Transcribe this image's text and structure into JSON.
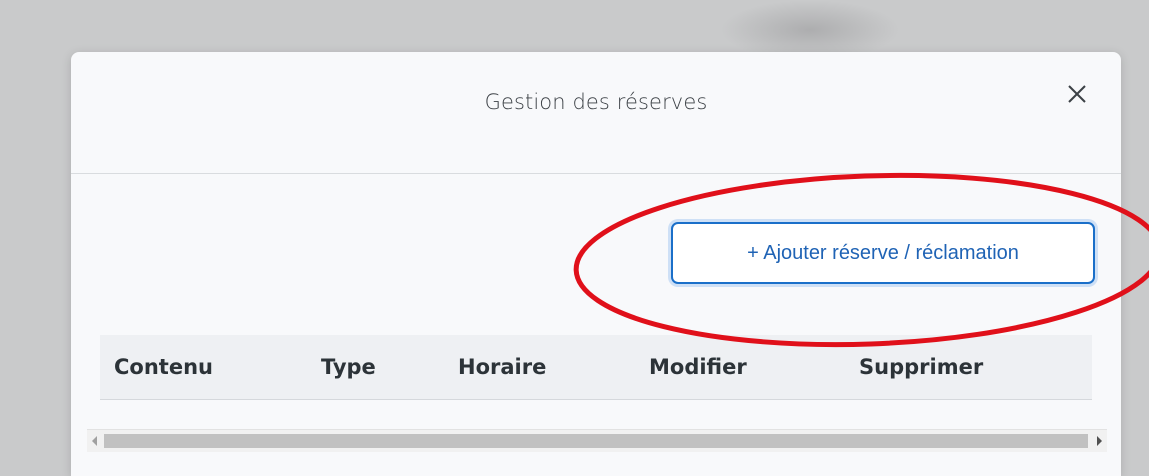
{
  "modal": {
    "title": "Gestion des réserves",
    "close_icon": "close-icon",
    "add_button_label": "+ Ajouter réserve / réclamation",
    "table": {
      "columns": [
        "Contenu",
        "Type",
        "Horaire",
        "Modifier",
        "Supprimer"
      ]
    }
  },
  "colors": {
    "button_border": "#1a6fc9",
    "button_text": "#1f63b5",
    "annotation_circle": "#e0101a",
    "modal_background": "#f8f9fb",
    "backdrop": "#c9cacb"
  }
}
